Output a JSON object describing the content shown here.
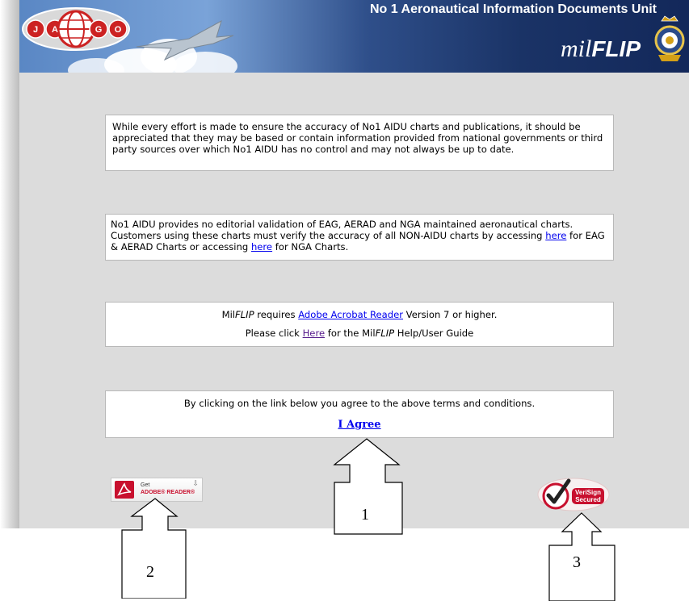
{
  "header": {
    "logo_left_letters": [
      "J",
      "A",
      "G",
      "O"
    ],
    "title": "No 1 Aeronautical Information Documents Unit",
    "brand_prefix": "mil",
    "brand_suffix": "FLIP",
    "crest_icon": "raf-crest-icon"
  },
  "disclaimer": {
    "text": "While every effort is made to ensure the accuracy of No1 AIDU charts and publications, it should be appreciated that they may be based or contain information provided from national governments or third party sources over which No1 AIDU has no control and may not always be up to date."
  },
  "validation": {
    "text_before_link1": "No1 AIDU provides no editorial validation of EAG, AERAD and NGA maintained aeronautical charts. Customers using these charts must verify the accuracy of all NON-AIDU charts by accessing ",
    "link1": "here",
    "text_middle": " for EAG & AERAD Charts or accessing ",
    "link2": "here",
    "text_after": " for NGA Charts."
  },
  "requirements": {
    "line1_prefix": "Mil",
    "line1_italic": "FLIP",
    "line1_before_link": " requires ",
    "acrobat_link": "Adobe Acrobat Reader",
    "line1_after_link": " Version 7 or higher.",
    "line2_prefix": "Please click ",
    "help_link": "Here",
    "line2_mid": " for the Mil",
    "line2_italic": "FLIP",
    "line2_suffix": " Help/User Guide"
  },
  "terms": {
    "text": "By clicking on the link below you agree to the above terms and conditions.",
    "agree_label": "I Agree"
  },
  "badges": {
    "adobe_get": "Get",
    "adobe_reader": "ADOBE® READER®",
    "verisign_line1": "VeriSign",
    "verisign_line2": "Secured"
  },
  "callouts": [
    "1",
    "2",
    "3"
  ],
  "colors": {
    "link": "#0000ee",
    "visited_link": "#551a8b",
    "page_bg": "#dcdcdc",
    "header_dark": "#13285a",
    "adobe_red": "#c8102e"
  }
}
